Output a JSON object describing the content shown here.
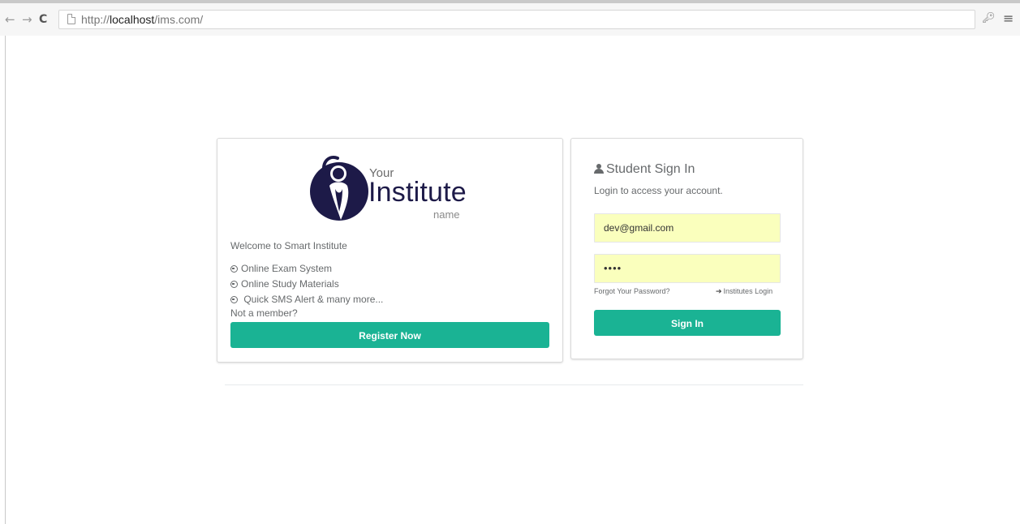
{
  "browser": {
    "nav_back": "←",
    "nav_forward": "→",
    "nav_reload": "C",
    "url_scheme": "http://",
    "url_host": "localhost",
    "url_path": "/ims.com/",
    "key_icon": "key-icon",
    "menu_icon": "menu-icon"
  },
  "info_panel": {
    "logo": {
      "your": "Your",
      "institute": "Institute",
      "name": "name"
    },
    "welcome": "Welcome to Smart Institute",
    "features": [
      "Online Exam System",
      "Online Study Materials",
      " Quick SMS Alert & many more..."
    ],
    "not_member": "Not a member?",
    "register_label": "Register Now"
  },
  "signin_panel": {
    "title": "Student Sign In",
    "subtitle": "Login to access your account.",
    "email_value": "dev@gmail.com",
    "password_value": "••••",
    "forgot_label": "Forgot Your Password?",
    "institutes_login_label": "Institutes Login",
    "signin_label": "Sign In"
  },
  "colors": {
    "accent": "#1ab394",
    "autofill": "#faffbd",
    "logo_dark": "#1d1a48"
  }
}
